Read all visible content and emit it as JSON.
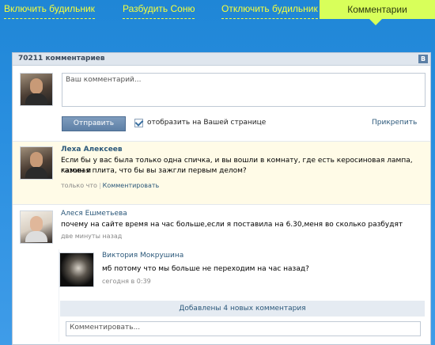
{
  "nav": {
    "items": [
      {
        "label": "Включить будильник"
      },
      {
        "label": "Разбудить Соню"
      },
      {
        "label": "Отключить будильник"
      }
    ],
    "active": {
      "label": "Комментарии"
    }
  },
  "widget": {
    "count_label": "70211 комментариев",
    "badge": "B",
    "compose": {
      "placeholder": "Ваш комментарий...",
      "send_label": "Отправить",
      "checkbox_label": "отобразить на Вашей странице",
      "checkbox_checked": true,
      "attach_label": "Прикрепить"
    },
    "comments": [
      {
        "author": "Леха Алексеев",
        "text_line1": "Если бы у вас была только одна спичка, и вы вошли в комнату, где есть керосиновая лампа, камин и",
        "text_line2": "газовая плита, что бы вы зажгли первым делом?",
        "time": "только что",
        "action": "Комментировать"
      },
      {
        "author": "Алеся Ешметьева",
        "text": "почему на сайте время на час больше,если я поставила на 6.30,меня во сколько разбудят",
        "time": "две минуты назад",
        "replies": [
          {
            "author": "Виктория Мокрушина",
            "text": "мб потому что мы больше не переходим на час назад?",
            "time": "сегодня в 0:39"
          }
        ],
        "new_comments_banner": "Добавлены 4 новых комментария",
        "reply_placeholder": "Комментировать..."
      }
    ]
  }
}
